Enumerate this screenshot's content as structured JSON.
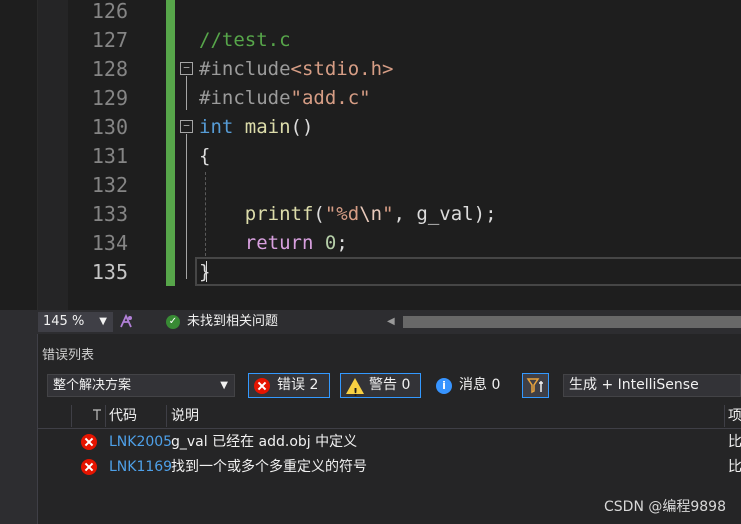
{
  "editor": {
    "line_numbers": [
      "126",
      "127",
      "128",
      "129",
      "130",
      "131",
      "132",
      "133",
      "134",
      "135"
    ],
    "current_line": "135",
    "code": {
      "l127_comment": "//test.c",
      "l128_directive": "#include",
      "l128_header": "<stdio.h>",
      "l129_directive": "#include",
      "l129_header": "\"add.c\"",
      "l130_type": "int",
      "l130_main": "main",
      "l130_parens": "()",
      "l131_brace": "{",
      "l133_printf": "printf",
      "l133_open": "(",
      "l133_str_a": "\"%d",
      "l133_esc": "\\n",
      "l133_str_b": "\"",
      "l133_sep": ", ",
      "l133_arg": "g_val",
      "l133_close": ");",
      "l134_return": "return",
      "l134_value": "0",
      "l134_semi": ";",
      "l135_brace": "}"
    },
    "fold_collapse_glyph": "−"
  },
  "status_bar": {
    "zoom": "145 %",
    "zoom_caret": "▼",
    "issues_text": "未找到相关问题",
    "ok_glyph": "✓",
    "scroll_left_glyph": "◀"
  },
  "error_list": {
    "title": "错误列表",
    "scope": "整个解决方案",
    "scope_caret": "▼",
    "errors_label": "错误 2",
    "warnings_label": "警告 0",
    "warning_glyph": "!",
    "messages_label": "消息 0",
    "info_glyph": "i",
    "build_filter": "生成 + IntelliSense",
    "columns": {
      "code": "代码",
      "description": "说明",
      "project": "项"
    },
    "rows": [
      {
        "code": "LNK2005",
        "description": "g_val 已经在 add.obj 中定义",
        "project": "比"
      },
      {
        "code": "LNK1169",
        "description": "找到一个或多个多重定义的符号",
        "project": "比"
      }
    ]
  },
  "watermark": "CSDN @编程9898",
  "colors": {
    "change_bar": "#57a64a",
    "error_red": "#e51400",
    "warning_yellow": "#f8d042",
    "info_blue": "#3794ff",
    "link_blue": "#4ea0e8"
  }
}
